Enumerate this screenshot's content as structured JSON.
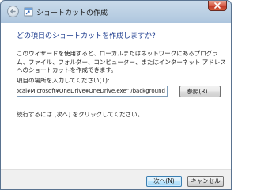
{
  "window": {
    "title": "ショートカットの作成"
  },
  "main": {
    "question": "どの項目のショートカットを作成しますか?",
    "description": "このウィザードを使用すると、ローカルまたはネットワークにあるプログラム、ファイル、フォルダー、コンピューター、またはインターネット アドレスへのショートカットを作成できます。",
    "location_label": "項目の場所を入力してください(T):",
    "location_value": "ory¥AppData¥Local¥Microsoft¥OneDrive¥OneDrive.exe\" /background",
    "browse_label": "参照(R)...",
    "continue_text": "続行するには [次へ] をクリックしてください。"
  },
  "footer": {
    "next_label": "次へ(N)",
    "cancel_label": "キャンセル"
  },
  "icons": {
    "back": "back-arrow-icon",
    "title": "shortcut-icon",
    "close": "close-icon"
  },
  "colors": {
    "question_text": "#1e3d8f",
    "close_button": "#c0392b",
    "default_button_border": "#3c7fb1"
  }
}
